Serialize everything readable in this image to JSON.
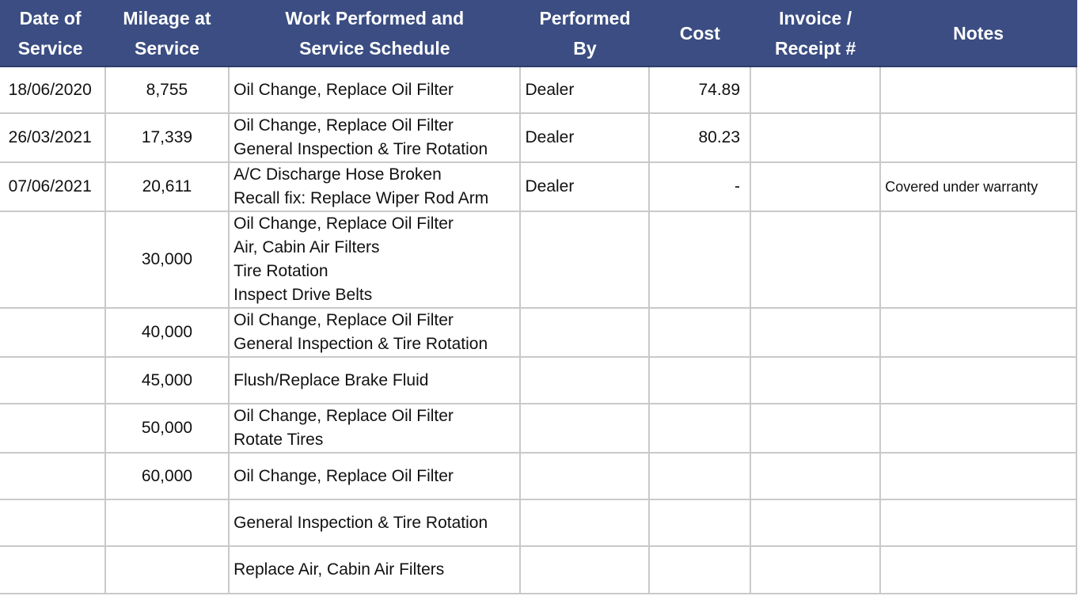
{
  "headers": [
    [
      "Date of",
      "Service"
    ],
    [
      "Mileage at",
      "Service"
    ],
    [
      "Work Performed and",
      "Service Schedule"
    ],
    [
      "Performed",
      "By"
    ],
    [
      "Cost"
    ],
    [
      "Invoice /",
      "Receipt #"
    ],
    [
      "Notes"
    ]
  ],
  "rows": [
    {
      "date": "18/06/2020",
      "mileage": "8,755",
      "work": [
        "Oil Change, Replace Oil Filter"
      ],
      "by": "Dealer",
      "cost": "74.89",
      "invoice": "",
      "notes": ""
    },
    {
      "date": "26/03/2021",
      "mileage": "17,339",
      "work": [
        "Oil Change, Replace Oil Filter",
        "General Inspection & Tire Rotation"
      ],
      "by": "Dealer",
      "cost": "80.23",
      "invoice": "",
      "notes": ""
    },
    {
      "date": "07/06/2021",
      "mileage": "20,611",
      "work": [
        "A/C Discharge Hose Broken",
        "Recall fix: Replace Wiper Rod Arm"
      ],
      "by": "Dealer",
      "cost": "-",
      "invoice": "",
      "notes": "Covered under warranty"
    },
    {
      "date": "",
      "mileage": "30,000",
      "work": [
        "Oil Change, Replace Oil Filter",
        "Air, Cabin Air Filters",
        "Tire Rotation",
        "Inspect Drive Belts"
      ],
      "by": "",
      "cost": "",
      "invoice": "",
      "notes": ""
    },
    {
      "date": "",
      "mileage": "40,000",
      "work": [
        "Oil Change, Replace Oil Filter",
        "General Inspection & Tire Rotation"
      ],
      "by": "",
      "cost": "",
      "invoice": "",
      "notes": ""
    },
    {
      "date": "",
      "mileage": "45,000",
      "work": [
        "Flush/Replace Brake Fluid"
      ],
      "by": "",
      "cost": "",
      "invoice": "",
      "notes": ""
    },
    {
      "date": "",
      "mileage": "50,000",
      "work": [
        "Oil Change, Replace Oil Filter",
        "Rotate Tires"
      ],
      "by": "",
      "cost": "",
      "invoice": "",
      "notes": ""
    },
    {
      "date": "",
      "mileage": "60,000",
      "work": [
        "Oil Change, Replace Oil Filter"
      ],
      "by": "",
      "cost": "",
      "invoice": "",
      "notes": ""
    },
    {
      "date": "",
      "mileage": "",
      "work": [
        "General Inspection & Tire Rotation"
      ],
      "by": "",
      "cost": "",
      "invoice": "",
      "notes": ""
    },
    {
      "date": "",
      "mileage": "",
      "work": [
        "Replace Air, Cabin Air Filters"
      ],
      "by": "",
      "cost": "",
      "invoice": "",
      "notes": ""
    }
  ],
  "colors": {
    "header_bg": "#3b4d82",
    "header_text": "#ffffff",
    "grid": "#c9c9c9"
  }
}
